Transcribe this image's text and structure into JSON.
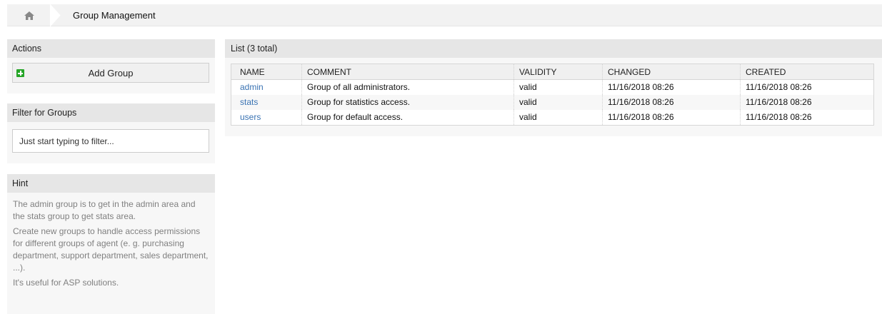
{
  "breadcrumb": {
    "home_icon": "home-icon",
    "current": "Group Management"
  },
  "actions": {
    "title": "Actions",
    "add_group_label": "Add Group",
    "add_icon": "plus-square-icon",
    "accent": "#25a527"
  },
  "filter": {
    "title": "Filter for Groups",
    "placeholder": "Just start typing to filter..."
  },
  "hint": {
    "title": "Hint",
    "paragraphs": [
      "The admin group is to get in the admin area and the stats group to get stats area.",
      "Create new groups to handle access permissions for different groups of agent (e. g. purchasing department, support department, sales department, ...).",
      "It's useful for ASP solutions."
    ]
  },
  "list": {
    "title": "List (3 total)",
    "columns": [
      "NAME",
      "COMMENT",
      "VALIDITY",
      "CHANGED",
      "CREATED"
    ],
    "rows": [
      {
        "name": "admin",
        "comment": "Group of all administrators.",
        "validity": "valid",
        "changed": "11/16/2018 08:26",
        "created": "11/16/2018 08:26"
      },
      {
        "name": "stats",
        "comment": "Group for statistics access.",
        "validity": "valid",
        "changed": "11/16/2018 08:26",
        "created": "11/16/2018 08:26"
      },
      {
        "name": "users",
        "comment": "Group for default access.",
        "validity": "valid",
        "changed": "11/16/2018 08:26",
        "created": "11/16/2018 08:26"
      }
    ],
    "link_color": "#3a73b3"
  }
}
